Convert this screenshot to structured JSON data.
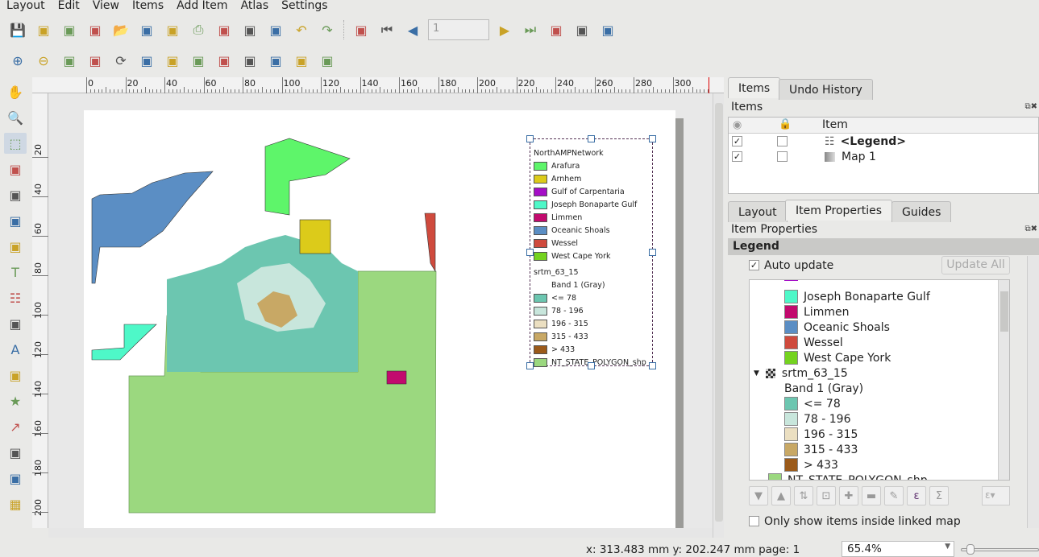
{
  "menu": [
    "Layout",
    "Edit",
    "View",
    "Items",
    "Add Item",
    "Atlas",
    "Settings"
  ],
  "toolbar1": [
    "save-icon",
    "new-layout-icon",
    "duplicate-layout-icon",
    "layout-manager-icon",
    "open-template-icon",
    "save-template-icon",
    "page-setup-icon",
    "print-icon",
    "export-image-icon",
    "export-svg-icon",
    "export-pdf-icon",
    "undo-icon",
    "redo-icon",
    "atlas-preview-icon",
    "first-feature-icon",
    "previous-feature-icon",
    "next-feature-icon",
    "last-feature-icon",
    "atlas-print-icon",
    "atlas-export-icon",
    "atlas-settings-icon"
  ],
  "atlas_page": "1",
  "toolbar2": [
    "zoom-in-icon",
    "zoom-out-icon",
    "zoom-100-icon",
    "zoom-full-icon",
    "refresh-icon",
    "lock-items-icon",
    "unlock-items-icon",
    "group-icon",
    "ungroup-icon",
    "raise-icon",
    "align-icon",
    "distribute-icon",
    "resize-icon"
  ],
  "lefttools": [
    "pan-icon",
    "zoom-tool-icon",
    "select-icon",
    "move-content-icon",
    "edit-nodes-icon",
    "add-map-icon",
    "add-picture-icon",
    "add-label-icon",
    "add-legend-icon",
    "add-scalebar-icon",
    "add-north-arrow-icon",
    "add-shape-icon",
    "add-marker-icon",
    "add-arrow-icon",
    "add-polyline-icon",
    "add-html-icon",
    "add-table-icon"
  ],
  "hruler": [
    "0",
    "20",
    "40",
    "60",
    "80",
    "100",
    "120",
    "140",
    "160",
    "180",
    "200",
    "220",
    "240",
    "260",
    "280",
    "300"
  ],
  "vruler": [
    "20",
    "40",
    "60",
    "80",
    "100",
    "120",
    "140",
    "160",
    "180",
    "200"
  ],
  "legend": {
    "group1": "NorthAMPNetwork",
    "items1": [
      {
        "label": "Arafura",
        "color": "#5ef56a"
      },
      {
        "label": "Arnhem",
        "color": "#dccb1a"
      },
      {
        "label": "Gulf of Carpentaria",
        "color": "#a50ec7"
      },
      {
        "label": "Joseph Bonaparte Gulf",
        "color": "#4ef8c8"
      },
      {
        "label": "Limmen",
        "color": "#c20a6e"
      },
      {
        "label": "Oceanic Shoals",
        "color": "#5b8ec4"
      },
      {
        "label": "Wessel",
        "color": "#cf4a3d"
      },
      {
        "label": "West Cape York",
        "color": "#74d31f"
      }
    ],
    "group2": "srtm_63_15",
    "band": "Band 1 (Gray)",
    "items2": [
      {
        "label": "<= 78",
        "color": "#6cc6b0"
      },
      {
        "label": "78 - 196",
        "color": "#c8e6dc"
      },
      {
        "label": "196 - 315",
        "color": "#ebdfc1"
      },
      {
        "label": "315 - 433",
        "color": "#c8a865"
      },
      {
        "label": "> 433",
        "color": "#9b5a1a"
      }
    ],
    "last": {
      "label": "NT_STATE_POLYGON_shp",
      "color": "#9bd87f"
    }
  },
  "right": {
    "tabs_top": [
      "Items",
      "Undo History"
    ],
    "items_title": "Items",
    "items_header": "Item",
    "items": [
      {
        "label": "<Legend>",
        "visible": true,
        "locked": false
      },
      {
        "label": "Map 1",
        "visible": true,
        "locked": false
      }
    ],
    "tabs_bottom": [
      "Layout",
      "Item Properties",
      "Guides"
    ],
    "props_title": "Item Properties",
    "section": "Legend",
    "auto_update": "Auto update",
    "update_all": "Update All",
    "tree": [
      {
        "label": "Joseph Bonaparte Gulf",
        "color": "#4ef8c8"
      },
      {
        "label": "Limmen",
        "color": "#c20a6e"
      },
      {
        "label": "Oceanic Shoals",
        "color": "#5b8ec4"
      },
      {
        "label": "Wessel",
        "color": "#cf4a3d"
      },
      {
        "label": "West Cape York",
        "color": "#74d31f"
      }
    ],
    "raster": "srtm_63_15",
    "band": "Band 1 (Gray)",
    "raster_items": [
      {
        "label": "<= 78",
        "color": "#6cc6b0"
      },
      {
        "label": "78 - 196",
        "color": "#c8e6dc"
      },
      {
        "label": "196 - 315",
        "color": "#ebdfc1"
      },
      {
        "label": "315 - 433",
        "color": "#c8a865"
      },
      {
        "label": "> 433",
        "color": "#9b5a1a"
      }
    ],
    "nt": "NT_STATE_POLYGON_shp",
    "only_show": "Only show items inside linked map",
    "expr_sym": "ε",
    "sum_sym": "Σ"
  },
  "status": {
    "coords": "x: 313.483 mm  y: 202.247 mm  page: 1",
    "zoom": "65.4%"
  }
}
